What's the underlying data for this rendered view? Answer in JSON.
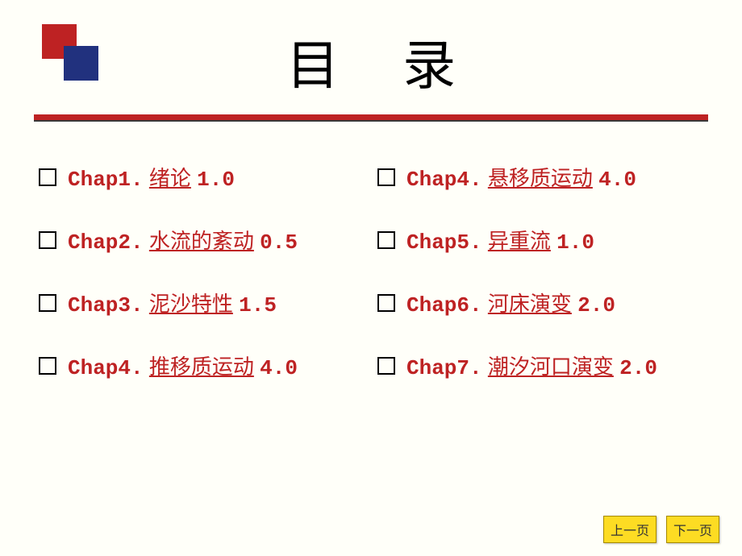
{
  "title": "目 录",
  "left_items": [
    {
      "prefix": "Chap1.",
      "link": "绪论",
      "suffix": "1.0"
    },
    {
      "prefix": "Chap2.",
      "link": "水流的紊动",
      "suffix": " 0.5"
    },
    {
      "prefix": "Chap3.",
      "link": "泥沙特性",
      "suffix": " 1.5"
    },
    {
      "prefix": "Chap4.",
      "link": "推移质运动",
      "suffix": " 4.0"
    }
  ],
  "right_items": [
    {
      "prefix": "Chap4.",
      "link": "悬移质运动",
      "suffix": " 4.0"
    },
    {
      "prefix": "Chap5.",
      "link": "异重流",
      "suffix": " 1.0"
    },
    {
      "prefix": "Chap6.",
      "link": "河床演变",
      "suffix": " 2.0"
    },
    {
      "prefix": "Chap7.",
      "link": "潮汐河口演变",
      "suffix": " 2.0"
    }
  ],
  "nav": {
    "prev": "上一页",
    "next": "下一页"
  }
}
